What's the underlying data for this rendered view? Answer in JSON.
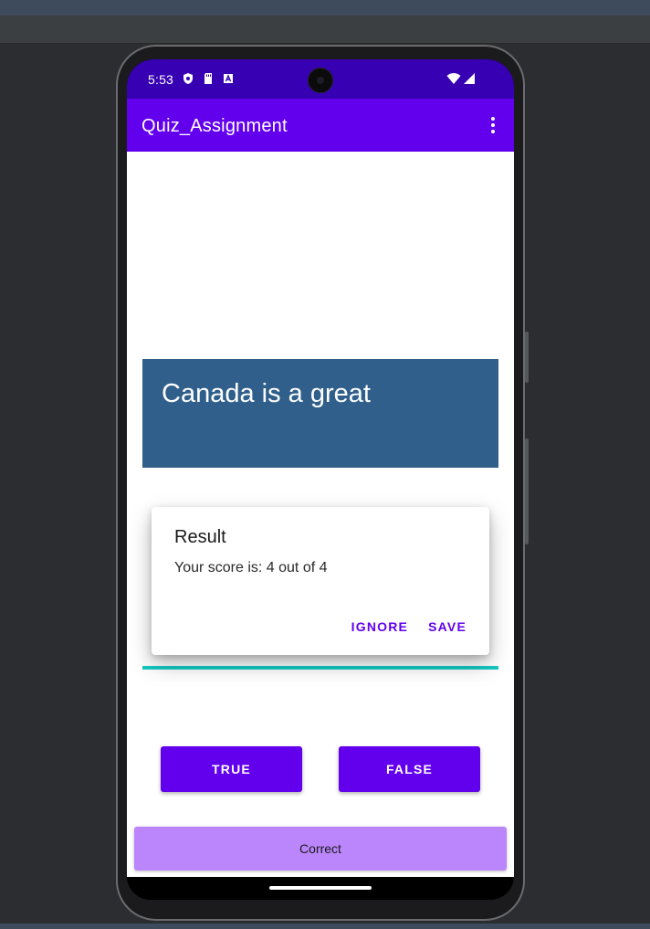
{
  "status_bar": {
    "time": "5:53",
    "left_icons": [
      "shield-icon",
      "sd-card-icon",
      "a-icon"
    ],
    "right_icons": [
      "wifi-icon",
      "cellular-signal-icon"
    ]
  },
  "app_bar": {
    "title": "Quiz_Assignment",
    "overflow_icon": "more-vert-icon"
  },
  "question": {
    "text": "Canada is a great"
  },
  "answer_buttons": {
    "true_label": "TRUE",
    "false_label": "FALSE"
  },
  "feedback": {
    "text": "Correct"
  },
  "dialog": {
    "title": "Result",
    "message": "Your score is: 4 out of 4",
    "ignore_label": "IGNORE",
    "save_label": "SAVE"
  },
  "colors": {
    "status_bar": "#3700b3",
    "primary": "#6200ee",
    "question_card": "#2f5f8a",
    "accent_line": "#16c9c4",
    "feedback_bar": "#bb86fc"
  }
}
